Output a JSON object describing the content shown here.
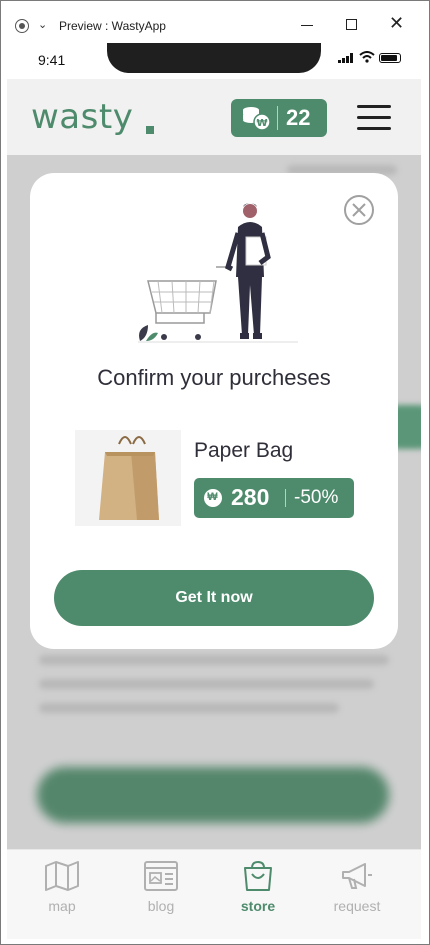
{
  "window": {
    "title": "Preview : WastyApp"
  },
  "status_bar": {
    "time": "9:41"
  },
  "header": {
    "logo_text": "wasty",
    "coin_count": "22"
  },
  "modal": {
    "title": "Confirm your purcheses",
    "product": {
      "name": "Paper Bag",
      "currency_symbol": "₩",
      "price": "280",
      "discount": "-50%"
    },
    "cta_label": "Get It now"
  },
  "bottom_nav": {
    "items": [
      {
        "label": "map",
        "icon": "map-icon",
        "active": false
      },
      {
        "label": "blog",
        "icon": "blog-icon",
        "active": false
      },
      {
        "label": "store",
        "icon": "store-bag-icon",
        "active": true
      },
      {
        "label": "request",
        "icon": "megaphone-icon",
        "active": false
      }
    ]
  },
  "colors": {
    "brand": "#4e8b6c",
    "inactive": "#b0b0b0",
    "text": "#2f2f3a"
  }
}
